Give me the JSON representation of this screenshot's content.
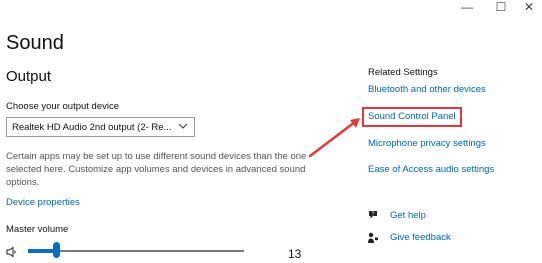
{
  "window_controls": {
    "minimize": "—",
    "maximize": "☐",
    "close": "✕"
  },
  "page": {
    "title": "Sound"
  },
  "output": {
    "heading": "Output",
    "choose_label": "Choose your output device",
    "device_value": "Realtek HD Audio 2nd output (2- Re...",
    "description": "Certain apps may be set up to use different sound devices than the one selected here. Customize app volumes and devices in advanced sound options.",
    "device_properties": "Device properties",
    "master_volume_label": "Master volume",
    "volume": 13
  },
  "related": {
    "heading": "Related Settings",
    "links": [
      "Bluetooth and other devices",
      "Sound Control Panel",
      "Microphone privacy settings",
      "Ease of Access audio settings"
    ]
  },
  "help": {
    "get_help": "Get help",
    "give_feedback": "Give feedback"
  },
  "colors": {
    "accent": "#0a6cc4",
    "link": "#0066b4",
    "highlight_box": "#e23a3a"
  },
  "icons": [
    "speaker-icon",
    "help-icon",
    "feedback-icon",
    "chevron-down-icon",
    "annotation-arrow"
  ]
}
